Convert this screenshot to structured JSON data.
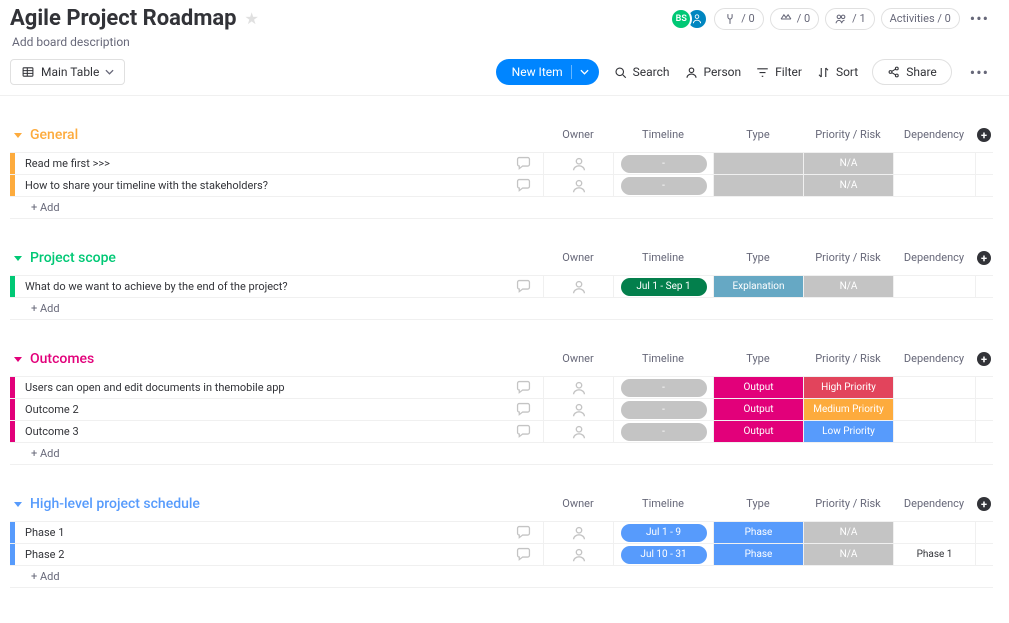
{
  "header": {
    "title": "Agile Project Roadmap",
    "description": "Add board description",
    "avatars": [
      {
        "initials": "BS",
        "bg": "#00c875"
      },
      {
        "initials": "",
        "bg": "#0086c0"
      }
    ],
    "chips": {
      "integrate": "/ 0",
      "automate": "/ 0",
      "invite": "/ 1",
      "activities": "Activities / 0"
    }
  },
  "toolbar": {
    "view": "Main Table",
    "new_item": "New Item",
    "search": "Search",
    "person": "Person",
    "filter": "Filter",
    "sort": "Sort",
    "share": "Share"
  },
  "columns": {
    "owner": "Owner",
    "timeline": "Timeline",
    "type": "Type",
    "priority": "Priority / Risk",
    "dependency": "Dependency"
  },
  "add_row_label": "+ Add",
  "groups": [
    {
      "id": "general",
      "title": "General",
      "color": "#fdab3d",
      "rows": [
        {
          "name": "Read me first >>>",
          "timeline": "-",
          "timeline_bg": "#c4c4c4",
          "type": "",
          "type_bg": "#c4c4c4",
          "priority": "N/A",
          "priority_bg": "#c4c4c4",
          "dep": ""
        },
        {
          "name": "How to share your timeline with the stakeholders?",
          "timeline": "-",
          "timeline_bg": "#c4c4c4",
          "type": "",
          "type_bg": "#c4c4c4",
          "priority": "N/A",
          "priority_bg": "#c4c4c4",
          "dep": ""
        }
      ]
    },
    {
      "id": "scope",
      "title": "Project scope",
      "color": "#00c875",
      "rows": [
        {
          "name": "What do we want to achieve by the end of the project?",
          "timeline": "Jul 1 - Sep 1",
          "timeline_bg": "#037f4c",
          "type": "Explanation",
          "type_bg": "#66a8c4",
          "priority": "N/A",
          "priority_bg": "#c4c4c4",
          "dep": ""
        }
      ]
    },
    {
      "id": "outcomes",
      "title": "Outcomes",
      "color": "#e2007a",
      "rows": [
        {
          "name": "Users can open and edit documents in themobile app",
          "timeline": "-",
          "timeline_bg": "#c4c4c4",
          "type": "Output",
          "type_bg": "#e2007a",
          "priority": "High Priority",
          "priority_bg": "#e2445c",
          "dep": ""
        },
        {
          "name": "Outcome 2",
          "timeline": "-",
          "timeline_bg": "#c4c4c4",
          "type": "Output",
          "type_bg": "#e2007a",
          "priority": "Medium Priority",
          "priority_bg": "#fdab3d",
          "dep": ""
        },
        {
          "name": "Outcome 3",
          "timeline": "-",
          "timeline_bg": "#c4c4c4",
          "type": "Output",
          "type_bg": "#e2007a",
          "priority": "Low Priority",
          "priority_bg": "#579bfc",
          "dep": ""
        }
      ]
    },
    {
      "id": "schedule",
      "title": "High-level project schedule",
      "color": "#579bfc",
      "rows": [
        {
          "name": "Phase 1",
          "timeline": "Jul 1 - 9",
          "timeline_bg": "#579bfc",
          "type": "Phase",
          "type_bg": "#579bfc",
          "priority": "N/A",
          "priority_bg": "#c4c4c4",
          "dep": ""
        },
        {
          "name": "Phase 2",
          "timeline": "Jul 10 - 31",
          "timeline_bg": "#579bfc",
          "type": "Phase",
          "type_bg": "#579bfc",
          "priority": "N/A",
          "priority_bg": "#c4c4c4",
          "dep": "Phase 1"
        }
      ]
    }
  ]
}
